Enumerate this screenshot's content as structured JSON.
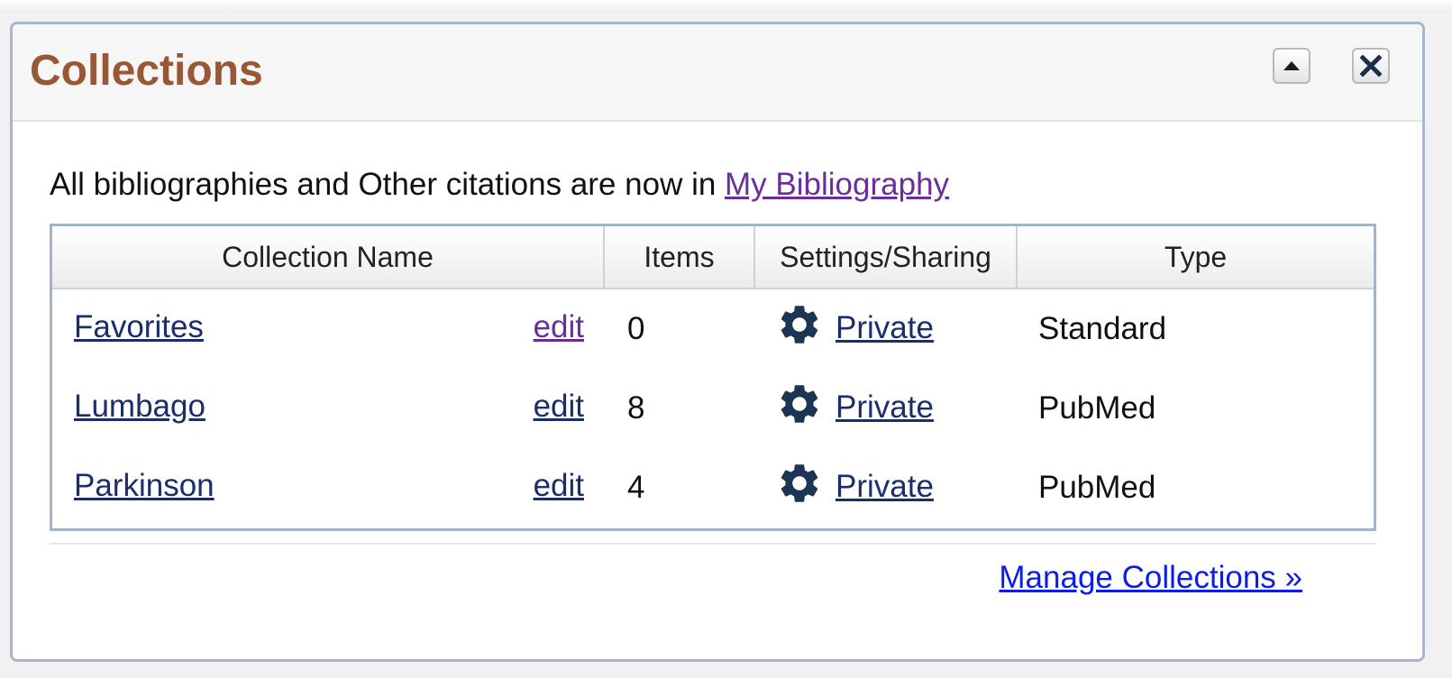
{
  "panel": {
    "title": "Collections",
    "collapse_icon": "triangle-up-icon",
    "close_icon": "close-x-icon"
  },
  "intro": {
    "text": "All bibliographies and Other citations are now in ",
    "link": "My Bibliography"
  },
  "table": {
    "headers": {
      "name": "Collection Name",
      "items": "Items",
      "settings": "Settings/Sharing",
      "type": "Type"
    },
    "rows": [
      {
        "name": "Favorites",
        "edit": "edit",
        "items": "0",
        "sharing": "Private",
        "type": "Standard"
      },
      {
        "name": "Lumbago",
        "edit": "edit",
        "items": "8",
        "sharing": "Private",
        "type": "PubMed"
      },
      {
        "name": "Parkinson",
        "edit": "edit",
        "items": "4",
        "sharing": "Private",
        "type": "PubMed"
      }
    ],
    "settings_icon": "gear-icon"
  },
  "footer": {
    "manage_link": "Manage Collections »"
  },
  "colors": {
    "title": "#985735",
    "link": "#1a2e6c",
    "visited_link": "#6b2d9b",
    "manage_link": "#0a1ee6",
    "panel_border": "#a7b8cc",
    "gear": "#1c3554"
  }
}
